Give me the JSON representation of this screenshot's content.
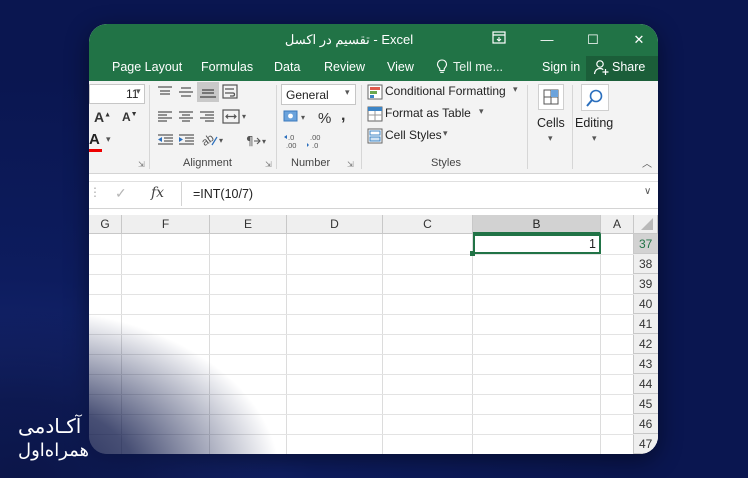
{
  "window": {
    "title": "تقسیم در اکسل - Excel",
    "controls": {
      "restore_ribbon": "⊡",
      "minimize": "—",
      "maximize": "☐",
      "close": "✕"
    }
  },
  "ribbon_tabs": {
    "items": [
      "Page Layout",
      "Formulas",
      "Data",
      "Review",
      "View"
    ],
    "tell_me": "Tell me...",
    "sign_in": "Sign in",
    "share": "Share"
  },
  "ribbon": {
    "font_size": "11",
    "number_format": "General",
    "conditional_formatting": "Conditional Formatting",
    "format_as_table": "Format as Table",
    "cell_styles": "Cell Styles",
    "cells": "Cells",
    "editing": "Editing",
    "groups": {
      "alignment": "Alignment",
      "number": "Number",
      "styles": "Styles"
    },
    "percent": "%",
    "comma": ",",
    "inc_decimal": "←.0 .00",
    "dec_decimal": ".00 →.0"
  },
  "formula_bar": {
    "cancel": "✕",
    "confirm": "✓",
    "fx": "fx",
    "formula": "=INT(10/7)"
  },
  "sheet": {
    "columns": [
      "G",
      "F",
      "E",
      "D",
      "C",
      "B",
      "A"
    ],
    "rows": [
      "37",
      "38",
      "39",
      "40",
      "41",
      "42",
      "43",
      "44",
      "45",
      "46",
      "47"
    ],
    "active_cell_value": "1",
    "accent": "#217346"
  },
  "brand": {
    "line1": "آکـادمی",
    "line2": "همراه‌اول"
  }
}
